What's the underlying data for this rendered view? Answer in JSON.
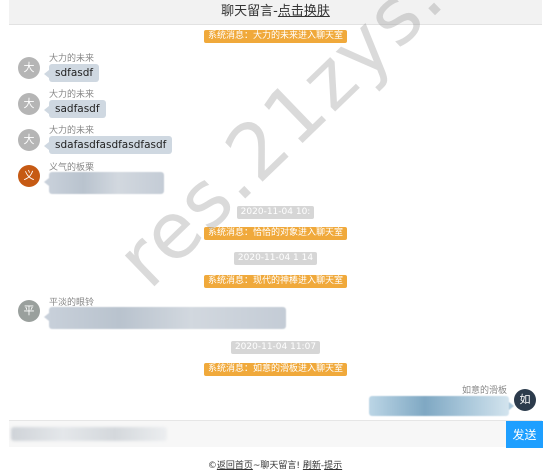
{
  "header": {
    "title": "聊天留言-",
    "link": "点击换肤"
  },
  "system_messages": [
    "系统消息：大力的未来进入聊天室",
    "系统消息：恰恰的对象进入聊天室",
    "系统消息：现代的神棒进入聊天室",
    "系统消息：如意的滑板进入聊天室"
  ],
  "timestamps": [
    "2020-11-04 10:",
    "2020-11-04 1 14",
    "2020-11-04 11:07"
  ],
  "messages": [
    {
      "avatar": "大",
      "name": "大力的未来",
      "text": "sdfasdf",
      "color": "#b5b5b5"
    },
    {
      "avatar": "大",
      "name": "大力的未来",
      "text": "sadfasdf",
      "color": "#b5b5b5"
    },
    {
      "avatar": "大",
      "name": "大力的未来",
      "text": "sdafasdfasdfasdfasdf",
      "color": "#b5b5b5"
    },
    {
      "avatar": "义",
      "name": "义气的板栗",
      "text": "",
      "color": "#c65a14"
    },
    {
      "avatar": "平",
      "name": "平淡的眼铃",
      "text": "",
      "color": "#9aa09d"
    },
    {
      "avatar": "如",
      "name": "如意的滑板",
      "text": "",
      "color": "#2c3b4c"
    }
  ],
  "input": {
    "placeholder": ""
  },
  "send_button": "发送",
  "footer": {
    "prefix": "©",
    "home_link": "返回首页",
    "middle": "~聊天留言! ",
    "refresh": "刷新",
    "sep": "-",
    "tip": "提示"
  },
  "watermark": "res.21zys.com",
  "colors": {
    "system_badge": "#f0a93b",
    "send_button": "#1e9fff",
    "bubble": "#cfd8e1"
  }
}
